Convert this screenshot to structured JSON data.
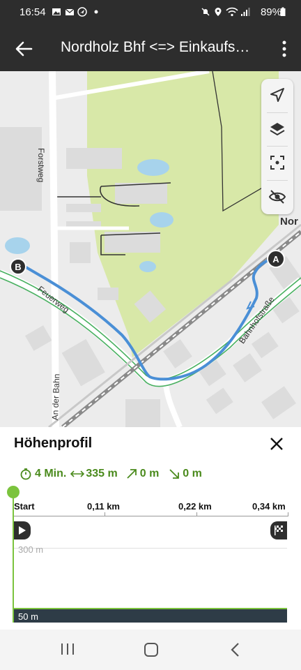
{
  "status_bar": {
    "time": "16:54",
    "battery": "89%",
    "left_icons": [
      "image-icon",
      "mail-icon",
      "navigation-icon",
      "dot-icon"
    ],
    "right_icons": [
      "mute-icon",
      "location-icon",
      "wifi-icon",
      "signal-icon",
      "battery-icon"
    ]
  },
  "app_bar": {
    "title": "Nordholz Bhf <=> Einkaufs…",
    "back_icon": "arrow-left-icon",
    "menu_icon": "more-vert-icon"
  },
  "map": {
    "labels": {
      "forstweg": "Forstweg",
      "feuerweg": "Feuerweg",
      "bahnhofstrasse": "Bahnhofstraße",
      "an_der_bahn": "An der Bahn",
      "nord": "Nor"
    },
    "markers": {
      "start": "A",
      "end": "B"
    },
    "colors": {
      "route": "#4a8fd6",
      "green_area": "#d6e6a6",
      "water": "#a7d3ec",
      "trail": "#48b060"
    }
  },
  "map_tools": [
    "locate-icon",
    "layers-icon",
    "fullscreen-icon",
    "visibility-off-icon"
  ],
  "elevation_panel": {
    "title": "Höhenprofil",
    "duration": "4 Min.",
    "distance": "335 m",
    "ascent": "0 m",
    "descent": "0 m",
    "axis": {
      "start": "Start",
      "km1": "0,11 km",
      "km2": "0,22 km",
      "km3": "0,34 km"
    },
    "y_labels": {
      "top": "300 m",
      "bottom": "50 m"
    },
    "colors": {
      "accent": "#7bc33d",
      "stats": "#4a8a1c",
      "ground": "#2e3c47"
    }
  },
  "nav_bar": [
    "recents-icon",
    "home-icon",
    "back-icon"
  ]
}
